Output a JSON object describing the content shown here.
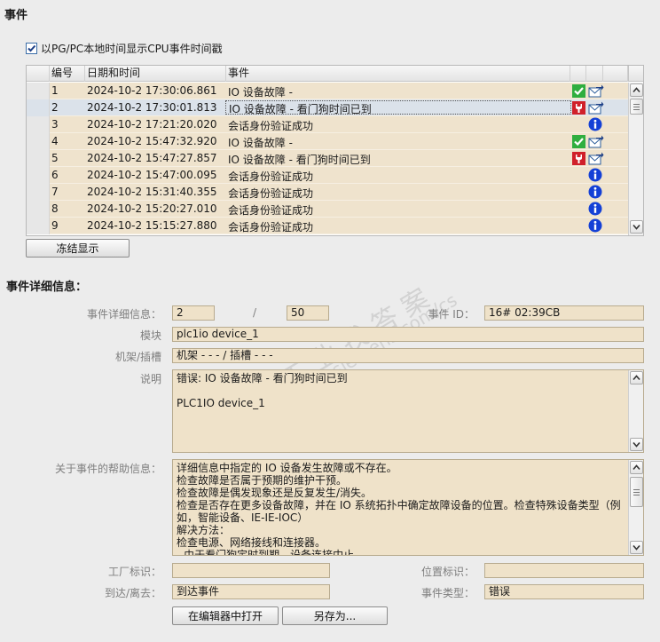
{
  "events_title": "事件",
  "show_local_time": {
    "label": "以PG/PC本地时间显示CPU事件时间戳",
    "checked": true
  },
  "table": {
    "headers": {
      "number": "编号",
      "datetime": "日期和时间",
      "event": "事件"
    },
    "rows": [
      {
        "number": "1",
        "datetime": "2024-10-2 17:30:06.861",
        "event": "IO 设备故障 -",
        "icon1": "check-icon",
        "icon2": "mail-arrow-icon"
      },
      {
        "number": "2",
        "datetime": "2024-10-2 17:30:01.813",
        "event": "IO 设备故障 - 看门狗时间已到",
        "icon1": "error-wrench-icon",
        "icon2": "mail-arrow-icon",
        "selected": true
      },
      {
        "number": "3",
        "datetime": "2024-10-2 17:21:20.020",
        "event": "会话身份验证成功",
        "icon2": "info-icon"
      },
      {
        "number": "4",
        "datetime": "2024-10-2 15:47:32.920",
        "event": "IO 设备故障 -",
        "icon1": "check-icon",
        "icon2": "mail-arrow-icon"
      },
      {
        "number": "5",
        "datetime": "2024-10-2 15:47:27.857",
        "event": "IO 设备故障 - 看门狗时间已到",
        "icon1": "error-wrench-icon",
        "icon2": "mail-arrow-icon"
      },
      {
        "number": "6",
        "datetime": "2024-10-2 15:47:00.095",
        "event": "会话身份验证成功",
        "icon2": "info-icon"
      },
      {
        "number": "7",
        "datetime": "2024-10-2 15:31:40.355",
        "event": "会话身份验证成功",
        "icon2": "info-icon"
      },
      {
        "number": "8",
        "datetime": "2024-10-2 15:20:27.010",
        "event": "会话身份验证成功",
        "icon2": "info-icon"
      },
      {
        "number": "9",
        "datetime": "2024-10-2 15:15:27.880",
        "event": "会话身份验证成功",
        "icon2": "info-icon"
      }
    ]
  },
  "freeze_button": "冻结显示",
  "details_title": "事件详细信息：",
  "details": {
    "detail_info_label": "事件详细信息：",
    "detail_index": "2",
    "detail_separator": "/",
    "detail_total": "50",
    "event_id_label": "事件 ID：",
    "event_id": "16# 02:39CB",
    "module_label": "模块",
    "module": "plc1io device_1",
    "rack_slot_label": "机架/插槽",
    "rack_slot": "机架 - - - / 插槽 - - -",
    "description_label": "说明",
    "description_lines": [
      "错误: IO 设备故障 - 看门狗时间已到",
      "",
      "PLC1IO device_1"
    ],
    "help_label": "关于事件的帮助信息：",
    "help_lines": [
      "详细信息中指定的 IO 设备发生故障或不存在。",
      "检查故障是否属于预期的维护干预。",
      "检查故障是偶发现象还是反复发生/消失。",
      "检查是否存在更多设备故障，并在 IO 系统拓扑中确定故障设备的位置。检查特殊设备类型（例如，智能设备、IE-IE-IOC）",
      "解决方法：",
      "检查电源、网络接线和连接器。",
      "- 由于看门狗定时到期，设备连接中止。"
    ],
    "plant_id_label": "工厂标识：",
    "plant_id": "",
    "location_id_label": "位置标识：",
    "location_id": "",
    "arrive_leave_label": "到达/离去：",
    "arrive_leave": "到达事件",
    "event_type_label": "事件类型：",
    "event_type": "错误"
  },
  "open_editor_button": "在编辑器中打开",
  "save_as_button": "另存为..."
}
